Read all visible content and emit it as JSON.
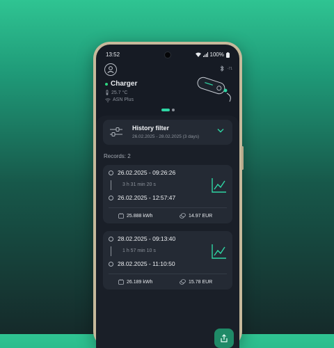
{
  "status_bar": {
    "time": "13:52",
    "battery": "100%"
  },
  "header": {
    "bluetooth_value": "-71",
    "charger_name": "Charger",
    "temperature": "25.7 °C",
    "network": "ASN Plus"
  },
  "filter": {
    "title": "History filter",
    "range": "26.02.2025 - 28.02.2025 (3 days)"
  },
  "records_label": "Records: 2",
  "records": [
    {
      "start": "26.02.2025 - 09:26:26",
      "duration": "3 h 31 min 20 s",
      "end": "26.02.2025 - 12:57:47",
      "energy": "25.888 kWh",
      "cost": "14.97 EUR"
    },
    {
      "start": "28.02.2025 - 09:13:40",
      "duration": "1 h 57 min 10 s",
      "end": "28.02.2025 - 11:10:50",
      "energy": "26.189 kWh",
      "cost": "15.78 EUR"
    }
  ],
  "colors": {
    "accent": "#2ed6a4",
    "online": "#2ed680",
    "background_top": "#2fc492"
  },
  "icons": {
    "avatar": "user-icon",
    "bluetooth": "bluetooth-icon",
    "temperature": "thermometer-icon",
    "wifi": "wifi-icon",
    "filter": "sliders-icon",
    "expand": "chevron-down-icon",
    "chart": "line-chart-icon",
    "energy": "battery-icon",
    "cost": "coins-icon",
    "share": "share-icon"
  }
}
